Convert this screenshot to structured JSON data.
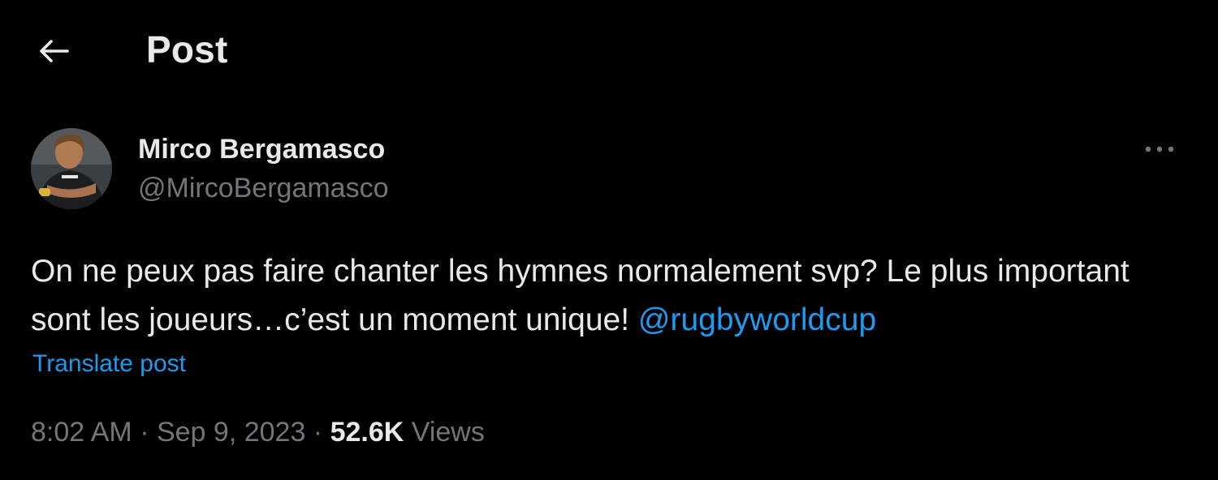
{
  "header": {
    "title": "Post"
  },
  "author": {
    "display_name": "Mirco Bergamasco",
    "handle": "@MircoBergamasco"
  },
  "post": {
    "text": "On ne peux pas faire chanter les hymnes normalement svp? Le plus important sont les joueurs…c’est un moment unique! ",
    "mention": "@rugbyworldcup",
    "translate_label": "Translate post"
  },
  "meta": {
    "time": "8:02 AM",
    "separator": " · ",
    "date": "Sep 9, 2023",
    "views_count": "52.6K",
    "views_label": " Views"
  },
  "icons": {
    "back": "arrow-left-icon",
    "more": "more-horizontal-icon"
  },
  "colors": {
    "background": "#000000",
    "text_primary": "#e7e9ea",
    "text_secondary": "#71767b",
    "accent": "#1d9bf0"
  }
}
